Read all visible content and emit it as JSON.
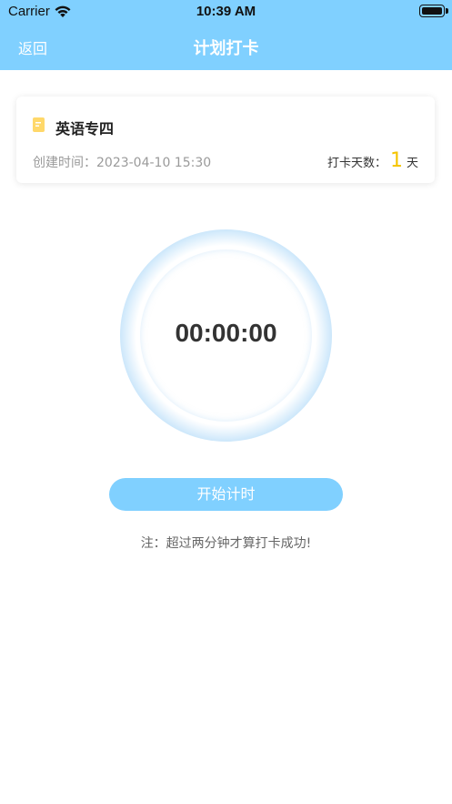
{
  "status_bar": {
    "carrier": "Carrier",
    "time": "10:39 AM"
  },
  "nav": {
    "back_label": "返回",
    "title": "计划打卡"
  },
  "plan": {
    "name": "英语专四",
    "created_label": "创建时间：2023-04-10 15:30",
    "days_label": "打卡天数：",
    "days_value": "1",
    "days_unit": "天"
  },
  "timer": {
    "display": "00:00:00"
  },
  "actions": {
    "start_label": "开始计时"
  },
  "note": "注：超过两分钟才算打卡成功!",
  "colors": {
    "accent": "#80d0ff",
    "days_highlight": "#f5c400"
  },
  "icons": {
    "plan": "note-icon",
    "wifi": "wifi-icon",
    "battery": "battery-icon"
  }
}
